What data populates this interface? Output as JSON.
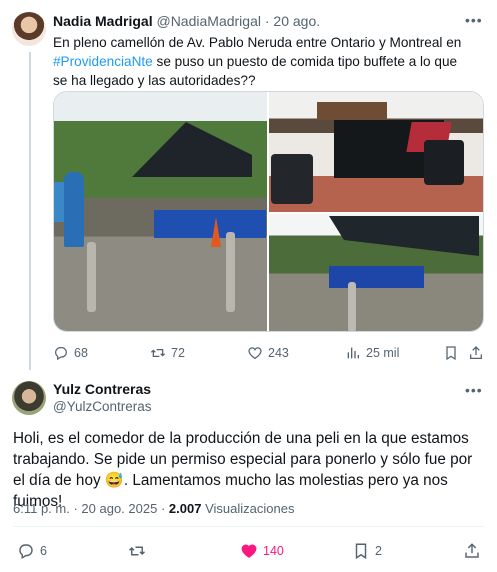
{
  "tweet1": {
    "author_name": "Nadia Madrigal",
    "handle": "@NadiaMadrigal",
    "separator": " · ",
    "date": "20 ago.",
    "text_before": "En pleno camellón de Av. Pablo Neruda entre Ontario y Montreal en ",
    "hashtag": "#ProvidenciaNte",
    "text_after": " se puso un puesto de comida tipo buffete a lo que se ha llegado y las autoridades??",
    "replies": "68",
    "retweets": "72",
    "likes": "243",
    "views": "25 mil"
  },
  "tweet2": {
    "author_name": "Yulz Contreras",
    "handle": "@YulzContreras",
    "text": "Holi, es el comedor de la producción de una peli en la que estamos trabajando. Se pide un permiso especial para ponerlo y sólo fue por el día de hoy 😅. Lamentamos mucho las molestias pero ya nos fuimos!",
    "time": "6:11 p. m.",
    "date": "20 ago. 2025",
    "views_count": "2.007",
    "views_label": "Visualizaciones",
    "replies": "6",
    "likes": "140",
    "bookmarks": "2"
  },
  "icons": {
    "more": "more-icon",
    "reply": "reply-icon",
    "retweet": "retweet-icon",
    "like": "heart-icon",
    "views": "views-icon",
    "bookmark": "bookmark-icon",
    "share": "share-icon"
  },
  "colors": {
    "accent": "#1d9bf0",
    "like_active": "#f91880",
    "muted": "#536471",
    "text": "#0f1419"
  }
}
